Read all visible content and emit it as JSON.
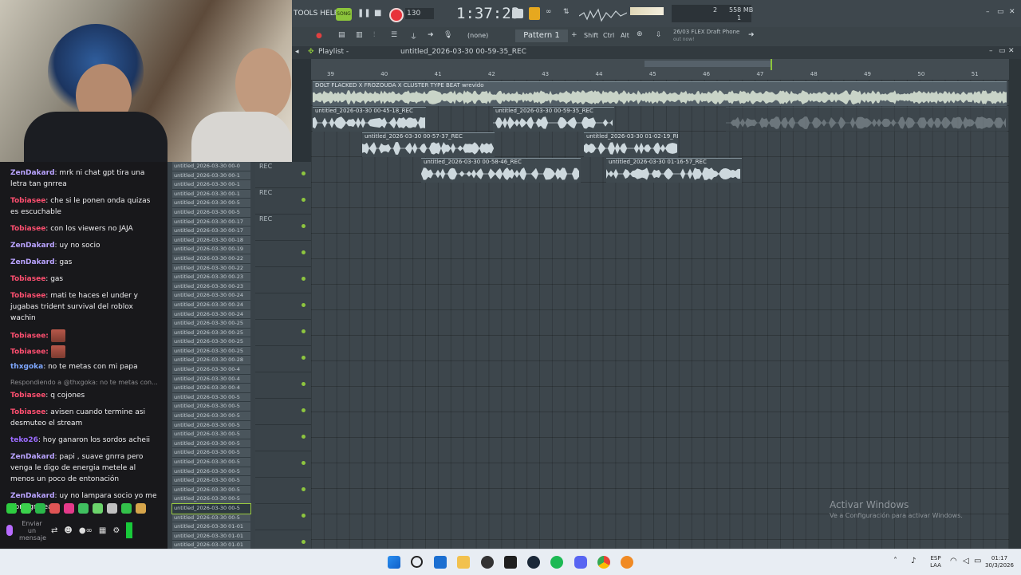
{
  "chat": {
    "messages": [
      {
        "user": "ZenDakard",
        "text": ": mrk ni chat gpt tira una letra tan gnrrea",
        "cls": "u-zen"
      },
      {
        "user": "Tobiasee",
        "text": ": che si le ponen onda quizas es escuchable",
        "cls": "u-tob"
      },
      {
        "user": "Tobiasee",
        "text": ": con los viewers no JAJA",
        "cls": "u-tob"
      },
      {
        "user": "ZenDakard",
        "text": ": uy no socio",
        "cls": "u-zen"
      },
      {
        "user": "ZenDakard",
        "text": ": gas",
        "cls": "u-zen"
      },
      {
        "user": "Tobiasee",
        "text": ": gas",
        "cls": "u-tob"
      },
      {
        "user": "Tobiasee",
        "text": ": mati te haces el under y jugabas trident survival del roblox wachin",
        "cls": "u-tob"
      }
    ],
    "emote_messages": [
      {
        "user": "Tobiasee"
      },
      {
        "user": "Tobiasee"
      }
    ],
    "messages2": [
      {
        "user": "thxgoka",
        "text": ": no te metas con mi papa",
        "cls": "u-thx"
      }
    ],
    "reply_note": "Respondiendo a @thxgoka: no te metas con...",
    "messages3": [
      {
        "user": "Tobiasee",
        "text": ": q cojones",
        "cls": "u-tob"
      },
      {
        "user": "Tobiasee",
        "text": ": avisen cuando termine asi desmuteo el stream",
        "cls": "u-tob"
      },
      {
        "user": "teko26",
        "text": ": hoy ganaron los sordos acheii",
        "cls": "u-tek"
      },
      {
        "user": "ZenDakard",
        "text": ": papi , suave gnrra pero venga le digo de energia metele al menos un poco de entonación",
        "cls": "u-zen"
      },
      {
        "user": "ZenDakard",
        "text": ": uy no lampara socio yo me abro gnrrea",
        "cls": "u-zen"
      }
    ],
    "input_placeholder": "Enviar un mensaje"
  },
  "browser": {
    "files": [
      "untitled_2026-03-30 00-0",
      "untitled_2026-03-30 00-1",
      "untitled_2026-03-30 00-1",
      "untitled_2026-03-30 00-1",
      "untitled_2026-03-30 00-5",
      "untitled_2026-03-30 00-5",
      "untitled_2026-03-30 00-17",
      "untitled_2026-03-30 00-17",
      "untitled_2026-03-30 00-18",
      "untitled_2026-03-30 00-19",
      "untitled_2026-03-30 00-22",
      "untitled_2026-03-30 00-22",
      "untitled_2026-03-30 00-23",
      "untitled_2026-03-30 00-23",
      "untitled_2026-03-30 00-24",
      "untitled_2026-03-30 00-24",
      "untitled_2026-03-30 00-24",
      "untitled_2026-03-30 00-25",
      "untitled_2026-03-30 00-25",
      "untitled_2026-03-30 00-25",
      "untitled_2026-03-30 00-25",
      "untitled_2026-03-30 00-28",
      "untitled_2026-03-30 00-4",
      "untitled_2026-03-30 00-4",
      "untitled_2026-03-30 00-4",
      "untitled_2026-03-30 00-5",
      "untitled_2026-03-30 00-5",
      "untitled_2026-03-30 00-5",
      "untitled_2026-03-30 00-5",
      "untitled_2026-03-30 00-5",
      "untitled_2026-03-30 00-5",
      "untitled_2026-03-30 00-5",
      "untitled_2026-03-30 00-5",
      "untitled_2026-03-30 00-5",
      "untitled_2026-03-30 00-5",
      "untitled_2026-03-30 00-5",
      "untitled_2026-03-30 00-5",
      "untitled_2026-03-30 00-5",
      "untitled_2026-03-30 00-5",
      "untitled_2026-03-30 01-01",
      "untitled_2026-03-30 01-01",
      "untitled_2026-03-30 01-01",
      "untitled_2026-03-30 01-02",
      "untitled_2026-03-30 01-04"
    ],
    "selected_index": 37
  },
  "tracks": {
    "labels": [
      "REC",
      "REC",
      "REC",
      "",
      "",
      "",
      "",
      "",
      "",
      "",
      "",
      "",
      "",
      "",
      ""
    ]
  },
  "topbar": {
    "menu": "TOOLS  HELP",
    "song_label": "SONG",
    "tempo": "130",
    "time": "1:37:23",
    "cpu": "2",
    "mem": "558 MB",
    "voices": "1"
  },
  "toolbar2": {
    "none_label": "(none)",
    "pattern": "Pattern 1",
    "shift": "Shift",
    "ctrl": "Ctrl",
    "alt": "Alt",
    "news_title": "26/03 FLEX Draft Phone",
    "news_sub": "out now!"
  },
  "playlist": {
    "title": "Playlist -",
    "arrangement": "untitled_2026-03-30 00-59-35_REC",
    "ruler": [
      "39",
      "40",
      "41",
      "42",
      "43",
      "44",
      "45",
      "46",
      "47",
      "48",
      "49",
      "50",
      "51"
    ],
    "clips": {
      "main": "DOLT FLACKED X FROZOUDA X CLUSTER TYPE BEAT wrevido",
      "c1": "untitled_2026-03-30 00-45-18_REC",
      "c2": "untitled_2026-03-30 00-59-35_REC",
      "c3": "untitled_2026-03-30 00-57-37_REC",
      "c4": "untitled_2026-03-30 01-02-19_REC",
      "c5": "untitled_2026-03-30 00-58-46_REC",
      "c6": "untitled_2026-03-30 01-16-57_REC"
    }
  },
  "watermark": {
    "title": "Activar Windows",
    "sub": "Ve a Configuración para activar Windows."
  },
  "taskbar": {
    "lang1": "ESP",
    "lang2": "LAA",
    "time": "01:17",
    "date": "30/3/2026"
  }
}
